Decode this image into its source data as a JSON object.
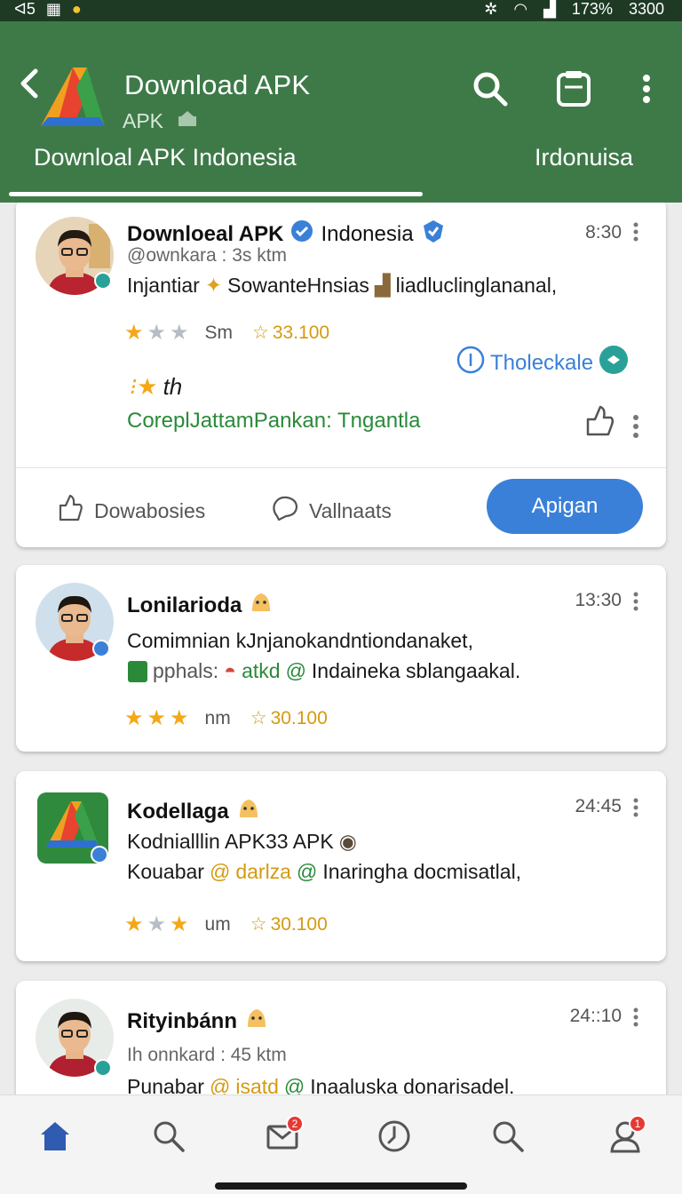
{
  "status_bar": {
    "left_text": "ᐊ5",
    "battery": "173%",
    "time": "3300"
  },
  "app_bar": {
    "title": "Download APK",
    "subtitle": "APK",
    "tabs": [
      {
        "label": "Downloal APK Indonesia",
        "active": true
      },
      {
        "label": "Irdonuisa",
        "active": false
      }
    ]
  },
  "colors": {
    "appbar_green": "#3e7a48",
    "status_dark": "#1e3a25",
    "primary_blue": "#3a80d8",
    "star_gold": "#f4a818",
    "link_green": "#2a8a3a"
  },
  "posts": [
    {
      "name_part1": "Downloeal APK",
      "name_part2": "Indonesia",
      "time": "8:30",
      "handle": "@ownkara : 3s ktm",
      "line1_a": "Injantiar",
      "line1_b": "SowanteHnsias",
      "line1_c": "liadluclinglananal,",
      "stars": 1,
      "rating_word": "Sm",
      "rating_score": "33.100",
      "action_link": "Tholeckale",
      "emoji_text": "th",
      "green_line": "CoreplJattamPankan: Tngantla",
      "footer": {
        "like_label": "Dowabosies",
        "comment_label": "Vallnaats",
        "primary_label": "Apigan"
      }
    },
    {
      "name": "Lonilarioda",
      "time": "13:30",
      "line1": "Comimnian kJnjanokandntiondanaket,",
      "line2_a": "pphals:",
      "line2_b": "atkd",
      "line2_c": "Indaineka sblangaakal.",
      "stars": 3,
      "rating_word": "nm",
      "rating_score": "30.100"
    },
    {
      "name": "Kodellaga",
      "time": "24:45",
      "line1": "Kodnialllin APK33 APK",
      "line2_a": "Kouabar",
      "line2_b": "darlza",
      "line2_c": "Inaringha docmisatlal,",
      "stars": 2,
      "rating_word": "um",
      "rating_score": "30.100"
    },
    {
      "name": "Rityinbánn",
      "time": "24::10",
      "handle": "Ih onnkard : 45 ktm",
      "line1_a": "Punabar",
      "line1_b": "isatd",
      "line1_c": "Inaaluska donarisadel."
    }
  ],
  "bottom_nav": {
    "items": [
      {
        "icon": "home-icon",
        "active": true
      },
      {
        "icon": "search-icon"
      },
      {
        "icon": "mail-icon",
        "badge": "2"
      },
      {
        "icon": "clock-icon"
      },
      {
        "icon": "search-icon"
      },
      {
        "icon": "profile-icon",
        "badge": "1"
      }
    ]
  }
}
